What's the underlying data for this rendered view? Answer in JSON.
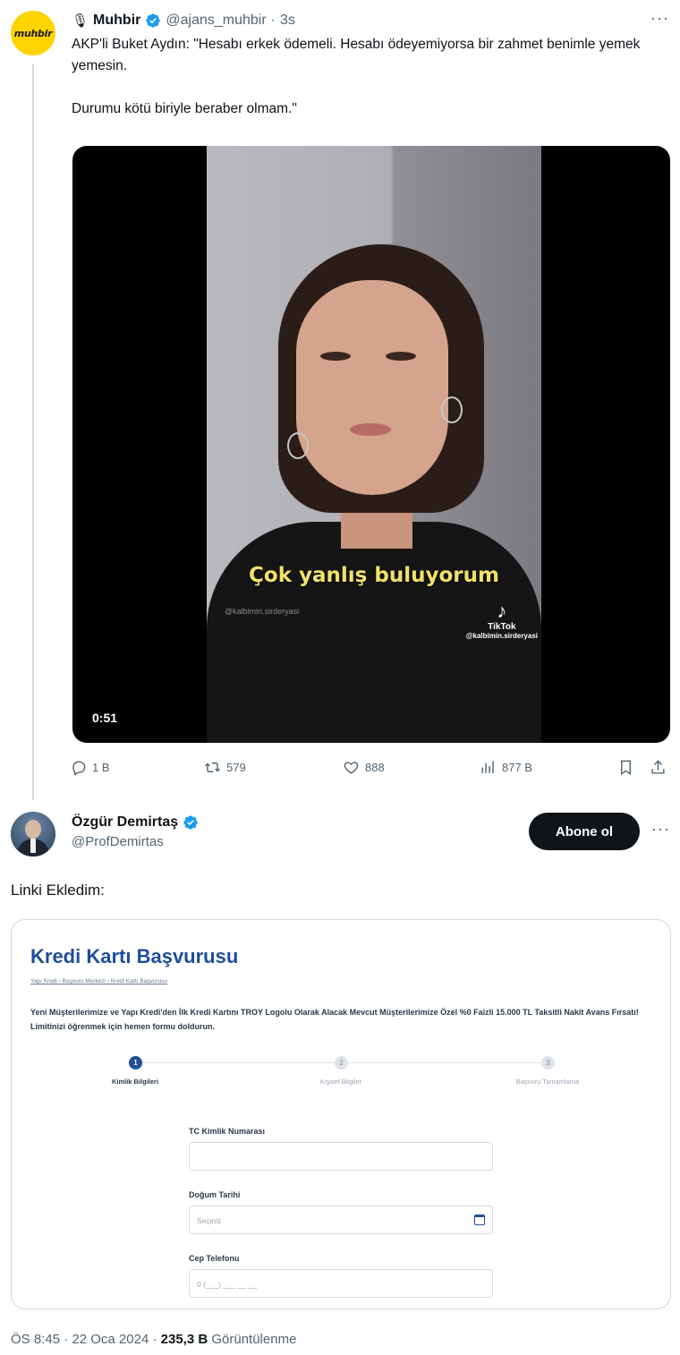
{
  "quoted_tweet": {
    "avatar_text": "muhbir",
    "mic_emoji": "🎙",
    "name": "Muhbir",
    "handle": "@ajans_muhbir",
    "separator": "·",
    "time": "3s",
    "text_line1": "AKP'li Buket Aydın: \"Hesabı erkek ödemeli. Hesabı ödeyemiyorsa bir zahmet benimle yemek yemesin.",
    "text_line2": "Durumu kötü biriyle beraber olmam.\"",
    "video": {
      "caption": "Çok yanlış buluyorum",
      "watermark_left": "@kalbimin.sirderyasi",
      "tiktok_label": "TikTok",
      "tiktok_handle": "@kalbimin.sirderyasi",
      "duration": "0:51"
    },
    "actions": {
      "replies": "1 B",
      "retweets": "579",
      "likes": "888",
      "views": "877 B"
    }
  },
  "tweet": {
    "name": "Özgür Demirtaş",
    "handle": "@ProfDemirtas",
    "follow_label": "Abone ol",
    "more": "···",
    "text": "Linki Ekledim:",
    "card": {
      "title": "Kredi Kartı Başvurusu",
      "breadcrumb": "Yapı Kredi › Başvuru Merkezi › Kredi Kartı Başvurusu",
      "description": "Yeni Müşterilerimize ve Yapı Kredi'den İlk Kredi Kartını TROY Logolu Olarak Alacak Mevcut Müşterilerimize Özel %0 Faizli 15.000 TL Taksitli Nakit Avans Fırsatı! Limitinizi öğrenmek için hemen formu doldurun.",
      "steps": [
        {
          "num": "1",
          "label": "Kimlik Bilgileri"
        },
        {
          "num": "2",
          "label": "Kişisel Bilgiler"
        },
        {
          "num": "3",
          "label": "Başvuru Tamamlama"
        }
      ],
      "fields": {
        "tc_label": "TC Kimlik Numarası",
        "tc_value": "",
        "dob_label": "Doğum Tarihi",
        "dob_placeholder": "Seçiniz",
        "phone_label": "Cep Telefonu",
        "phone_placeholder": "0 (___) ___ __ __"
      }
    },
    "meta": {
      "time": "ÖS 8:45",
      "sep": "·",
      "date": "22 Oca 2024",
      "views": "235,3 B",
      "views_label": "Görüntülenme"
    }
  },
  "colors": {
    "accent": "#1d9bf0",
    "muted": "#536471",
    "card_title": "#1f4e9a",
    "muhbir_yellow": "#ffd400"
  },
  "icons": [
    "microphone-icon",
    "verified-icon",
    "reply-icon",
    "retweet-icon",
    "like-icon",
    "views-icon",
    "bookmark-icon",
    "share-icon",
    "calendar-icon",
    "tiktok-icon",
    "more-icon"
  ]
}
